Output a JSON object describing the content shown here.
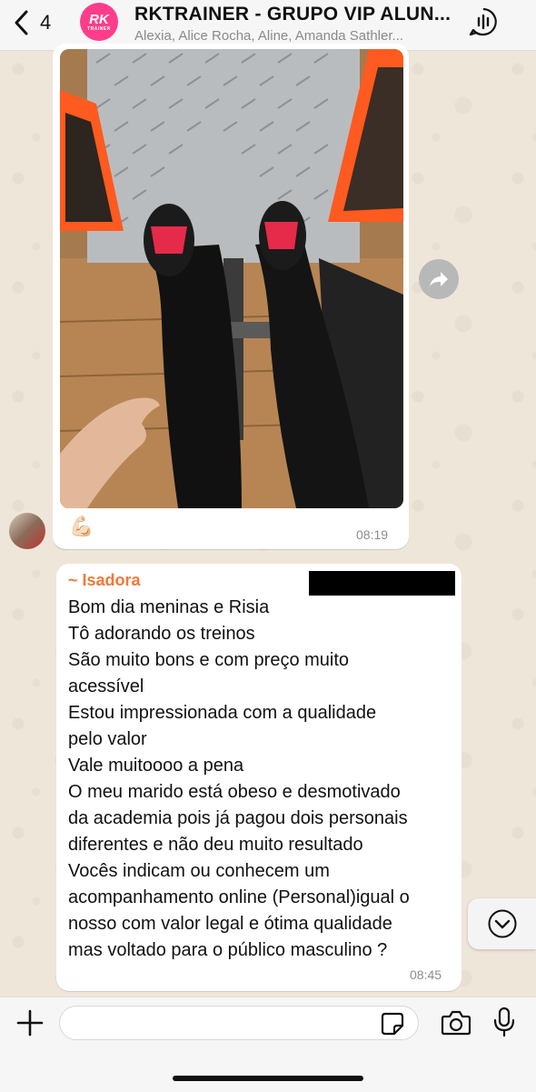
{
  "header": {
    "back_count": "4",
    "title": "RKTRAINER - GRUPO VIP ALUN...",
    "members": "Alexia, Alice Rocha, Aline, Amanda Sathler...",
    "avatar_text": "RK",
    "avatar_sub": "TRAINER"
  },
  "messages": [
    {
      "type": "image",
      "caption": "💪🏻",
      "time": "08:19"
    },
    {
      "type": "text",
      "sender": "~ Isadora",
      "lines": [
        "Bom dia meninas e Risia",
        "Tô adorando os treinos",
        "São muito bons e com preço muito",
        "acessível",
        "Estou impressionada com a qualidade",
        "pelo valor",
        "Vale muitoooo a pena",
        "O meu marido está obeso e desmotivado",
        "da academia pois já pagou dois personais",
        "diferentes e não deu muito resultado",
        "Vocês indicam ou conhecem um",
        "acompanhamento online (Personal)igual o",
        "nosso com valor legal e ótima qualidade",
        "mas voltado para o público masculino ?"
      ],
      "time": "08:45"
    }
  ],
  "input": {
    "value": "",
    "placeholder": ""
  },
  "colors": {
    "sender_name": "#f0793a",
    "brand_pink": "#ff3d8b",
    "wallpaper": "#efe6da"
  },
  "icons": [
    "back-chevron-icon",
    "group-call-icon",
    "forward-icon",
    "scroll-down-icon",
    "plus-icon",
    "sticker-icon",
    "camera-icon",
    "microphone-icon"
  ]
}
